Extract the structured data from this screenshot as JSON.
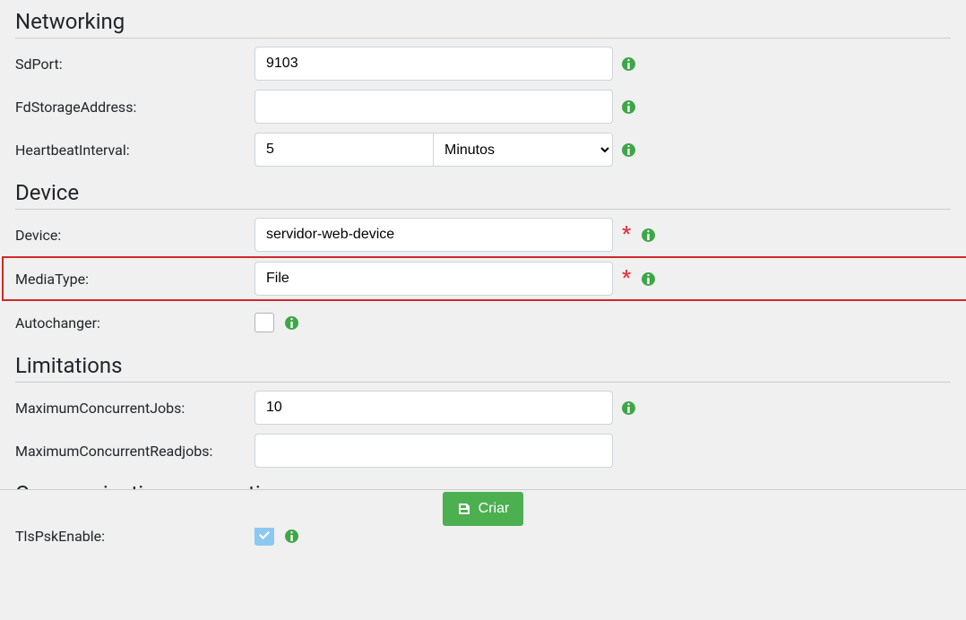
{
  "sections": {
    "networking": {
      "title": "Networking"
    },
    "device": {
      "title": "Device"
    },
    "limitations": {
      "title": "Limitations"
    },
    "comms": {
      "title": "Communications encryption"
    }
  },
  "fields": {
    "sdport": {
      "label": "SdPort:",
      "value": "9103"
    },
    "fdstorageaddress": {
      "label": "FdStorageAddress:",
      "value": ""
    },
    "heartbeatinterval": {
      "label": "HeartbeatInterval:",
      "value": "5",
      "unit": "Minutos"
    },
    "device": {
      "label": "Device:",
      "value": "servidor-web-device"
    },
    "mediatype": {
      "label": "MediaType:",
      "value": "File"
    },
    "autochanger": {
      "label": "Autochanger:",
      "checked": false
    },
    "maxconcjobs": {
      "label": "MaximumConcurrentJobs:",
      "value": "10"
    },
    "maxconcreadjobs": {
      "label": "MaximumConcurrentReadjobs:",
      "value": ""
    },
    "tlspskenable": {
      "label": "TlsPskEnable:",
      "checked": true
    }
  },
  "buttons": {
    "create": "Criar"
  }
}
